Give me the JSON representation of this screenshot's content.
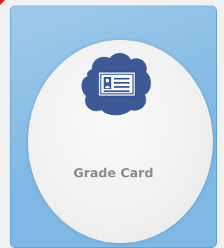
{
  "tile": {
    "label": "Grade Card",
    "icon": "id-card-cloud-icon",
    "colors": {
      "tile_bg": "#7fb8e4",
      "disc_bg": "#f2f2f2",
      "icon_bg": "#3d5a96",
      "label_text": "#8c8c8c",
      "corner_ribbon": "#e02020"
    }
  }
}
